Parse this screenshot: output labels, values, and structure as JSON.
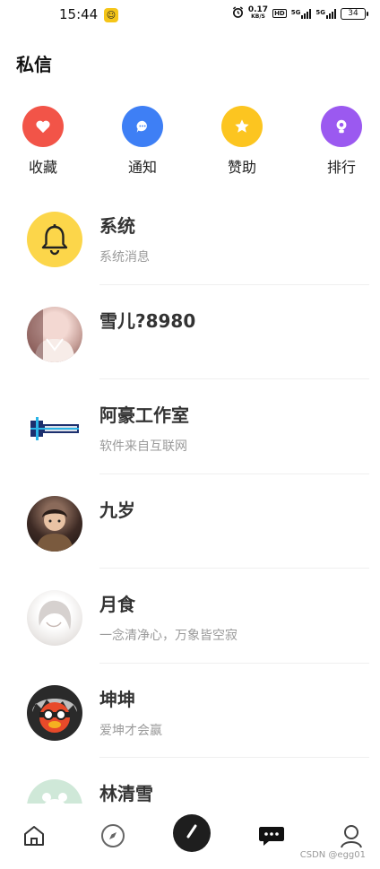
{
  "status_bar": {
    "time": "15:44",
    "net_speed_value": "0.17",
    "net_speed_unit": "KB/S",
    "hd": "HD",
    "sim1": "5G",
    "sim2": "5G",
    "battery": "34"
  },
  "header": {
    "title": "私信"
  },
  "quick_actions": [
    {
      "label": "收藏",
      "icon": "heart-icon",
      "color": "#f25448"
    },
    {
      "label": "通知",
      "icon": "chat-bubble-icon",
      "color": "#3e7ff5"
    },
    {
      "label": "赞助",
      "icon": "star-icon",
      "color": "#fcc520"
    },
    {
      "label": "排行",
      "icon": "trophy-icon",
      "color": "#9b59f0"
    }
  ],
  "messages": [
    {
      "name": "系统",
      "preview": "系统消息"
    },
    {
      "name": "雪儿?8980",
      "preview": ""
    },
    {
      "name": "阿豪工作室",
      "preview": "软件来自互联网"
    },
    {
      "name": "九岁",
      "preview": ""
    },
    {
      "name": "月食",
      "preview": "一念清净心，万象皆空寂"
    },
    {
      "name": "坤坤",
      "preview": "爱坤才会赢"
    },
    {
      "name": "林清雪",
      "preview": ""
    }
  ],
  "tab_bar": {
    "tabs": [
      "home-icon",
      "compass-icon",
      "compose-icon",
      "messages-icon",
      "profile-icon"
    ],
    "watermark": "CSDN @egg01"
  }
}
